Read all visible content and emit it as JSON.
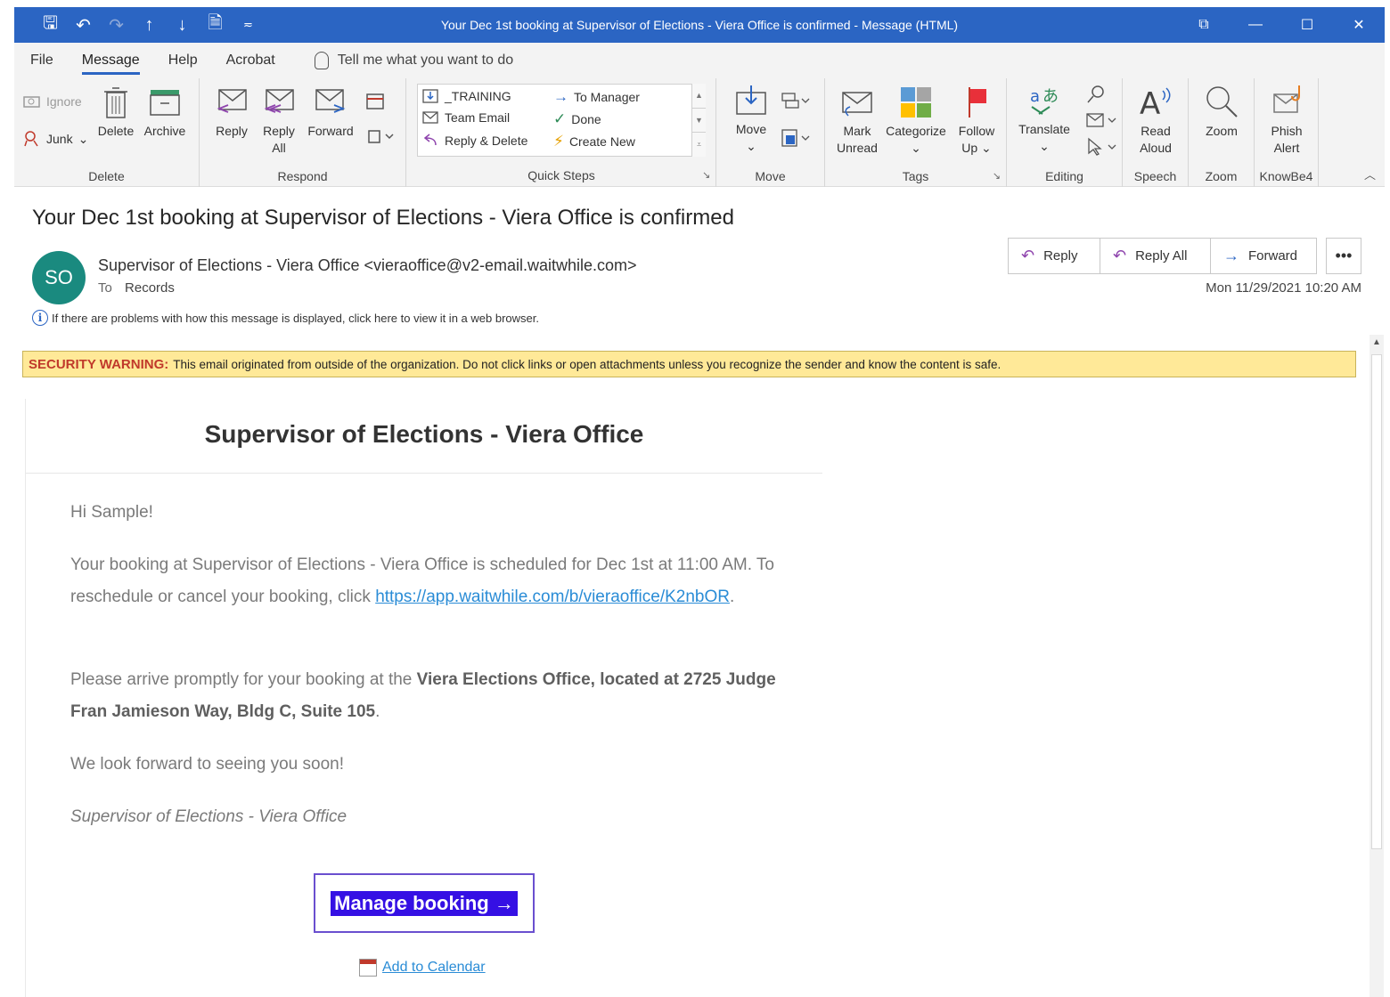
{
  "window": {
    "title": "Your Dec 1st booking at Supervisor of Elections - Viera Office is confirmed  -  Message (HTML)",
    "controls": {
      "restore": "⧉",
      "minimize": "—",
      "maximize": "☐",
      "close": "✕"
    }
  },
  "qat": [
    {
      "name": "save-icon",
      "glyph": "🖫"
    },
    {
      "name": "undo-icon",
      "glyph": "↶"
    },
    {
      "name": "redo-icon",
      "glyph": "↷"
    },
    {
      "name": "previous-item-icon",
      "glyph": "↑"
    },
    {
      "name": "next-item-icon",
      "glyph": "↓"
    },
    {
      "name": "print-icon",
      "glyph": "🗎"
    },
    {
      "name": "customize-qat-icon",
      "glyph": "≂"
    }
  ],
  "tabs": [
    "File",
    "Message",
    "Help",
    "Acrobat"
  ],
  "tellme": "Tell me what you want to do",
  "ribbon": {
    "delete_group": {
      "label": "Delete",
      "ignore": "Ignore",
      "junk": "Junk",
      "delete": "Delete",
      "archive": "Archive"
    },
    "respond_group": {
      "label": "Respond",
      "reply": "Reply",
      "reply_all_1": "Reply",
      "reply_all_2": "All",
      "forward": "Forward"
    },
    "quick_steps": {
      "label": "Quick Steps",
      "training": "_TRAINING",
      "team_email": "Team Email",
      "reply_delete": "Reply & Delete",
      "to_manager": "To Manager",
      "done": "Done",
      "create_new": "Create New"
    },
    "move_group": {
      "label": "Move",
      "move": "Move"
    },
    "tags_group": {
      "label": "Tags",
      "mark_1": "Mark",
      "mark_2": "Unread",
      "categorize": "Categorize",
      "follow_1": "Follow",
      "follow_2": "Up"
    },
    "editing_group": {
      "label": "Editing",
      "translate": "Translate"
    },
    "speech_group": {
      "label": "Speech",
      "read_1": "Read",
      "read_2": "Aloud"
    },
    "zoom_group": {
      "label": "Zoom",
      "zoom": "Zoom"
    },
    "knowbe4_group": {
      "label": "KnowBe4",
      "phish_1": "Phish",
      "phish_2": "Alert"
    }
  },
  "message": {
    "subject": "Your Dec 1st booking at Supervisor of Elections - Viera Office is confirmed",
    "avatar_initials": "SO",
    "sender": "Supervisor of Elections - Viera Office <vieraoffice@v2-email.waitwhile.com>",
    "to_label": "To",
    "to_value": "Records",
    "date": "Mon 11/29/2021 10:20 AM",
    "actions": {
      "reply": "Reply",
      "reply_all": "Reply All",
      "forward": "Forward",
      "more": "•••"
    },
    "info_bar": "If there are problems with how this message is displayed, click here to view it in a web browser."
  },
  "security_warning": {
    "tag": "SECURITY WARNING:",
    "text": "This email originated from outside of the organization. Do not click links or open attachments unless you recognize the sender and know the content is safe."
  },
  "email_body": {
    "header": "Supervisor of Elections - Viera Office",
    "greeting": "Hi Sample!",
    "p1_text": "Your booking at Supervisor of Elections - Viera Office is scheduled for Dec 1st at 11:00 AM. To reschedule or cancel your booking, click ",
    "p1_link": "https://app.waitwhile.com/b/vieraoffice/K2nbOR",
    "p1_end": ".",
    "p2_text": "Please arrive promptly for your booking at the ",
    "p2_bold": "Viera Elections Office, located at 2725 Judge Fran Jamieson Way, Bldg C, Suite 105",
    "p2_end": ".",
    "p3": "We look forward to seeing you soon!",
    "signature": "Supervisor of Elections - Viera Office",
    "manage_button": "Manage booking →",
    "add_calendar": "Add to Calendar"
  },
  "colors": {
    "titlebar": "#2b65c3",
    "avatar": "#1a8a7f",
    "warning_bg": "#ffe998",
    "warning_tag": "#c0392b",
    "link": "#2a8cd6",
    "manage_bg": "#3510e4"
  }
}
